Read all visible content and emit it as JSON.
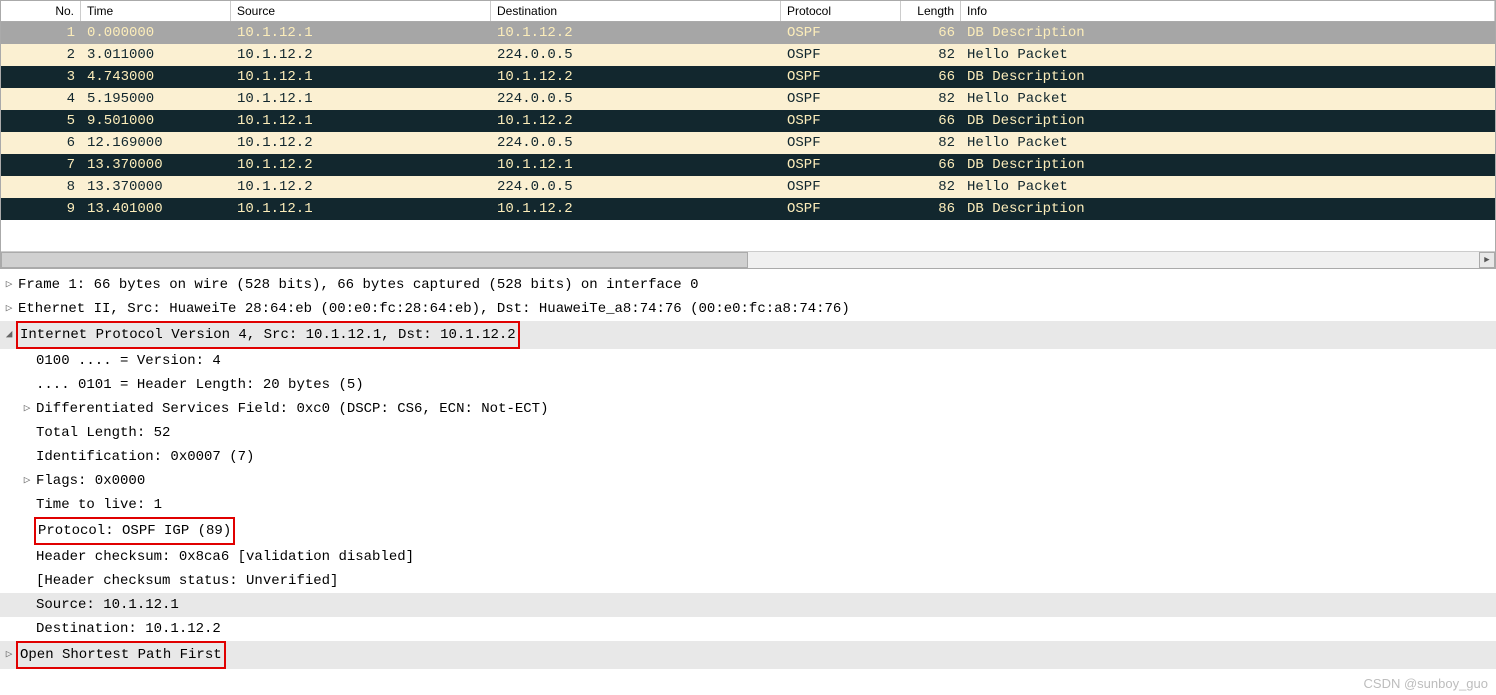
{
  "columns": {
    "no": "No.",
    "time": "Time",
    "src": "Source",
    "dst": "Destination",
    "proto": "Protocol",
    "len": "Length",
    "info": "Info"
  },
  "packets": [
    {
      "no": "1",
      "time": "0.000000",
      "src": "10.1.12.1",
      "dst": "10.1.12.2",
      "proto": "OSPF",
      "len": "66",
      "info": "DB Description",
      "theme": "sel"
    },
    {
      "no": "2",
      "time": "3.011000",
      "src": "10.1.12.2",
      "dst": "224.0.0.5",
      "proto": "OSPF",
      "len": "82",
      "info": "Hello Packet",
      "theme": "light"
    },
    {
      "no": "3",
      "time": "4.743000",
      "src": "10.1.12.1",
      "dst": "10.1.12.2",
      "proto": "OSPF",
      "len": "66",
      "info": "DB Description",
      "theme": "dark"
    },
    {
      "no": "4",
      "time": "5.195000",
      "src": "10.1.12.1",
      "dst": "224.0.0.5",
      "proto": "OSPF",
      "len": "82",
      "info": "Hello Packet",
      "theme": "light"
    },
    {
      "no": "5",
      "time": "9.501000",
      "src": "10.1.12.1",
      "dst": "10.1.12.2",
      "proto": "OSPF",
      "len": "66",
      "info": "DB Description",
      "theme": "dark"
    },
    {
      "no": "6",
      "time": "12.169000",
      "src": "10.1.12.2",
      "dst": "224.0.0.5",
      "proto": "OSPF",
      "len": "82",
      "info": "Hello Packet",
      "theme": "light"
    },
    {
      "no": "7",
      "time": "13.370000",
      "src": "10.1.12.2",
      "dst": "10.1.12.1",
      "proto": "OSPF",
      "len": "66",
      "info": "DB Description",
      "theme": "dark"
    },
    {
      "no": "8",
      "time": "13.370000",
      "src": "10.1.12.2",
      "dst": "224.0.0.5",
      "proto": "OSPF",
      "len": "82",
      "info": "Hello Packet",
      "theme": "light"
    },
    {
      "no": "9",
      "time": "13.401000",
      "src": "10.1.12.1",
      "dst": "10.1.12.2",
      "proto": "OSPF",
      "len": "86",
      "info": "DB Description",
      "theme": "dark"
    }
  ],
  "details": {
    "frame": "Frame 1: 66 bytes on wire (528 bits), 66 bytes captured (528 bits) on interface 0",
    "eth": "Ethernet II, Src: HuaweiTe 28:64:eb (00:e0:fc:28:64:eb), Dst: HuaweiTe_a8:74:76 (00:e0:fc:a8:74:76)",
    "ipv4_header": "Internet Protocol Version 4, Src: 10.1.12.1, Dst: 10.1.12.2",
    "ipv4": {
      "version": "0100 .... = Version: 4",
      "hdrlen": ".... 0101 = Header Length: 20 bytes (5)",
      "dscp": "Differentiated Services Field: 0xc0 (DSCP: CS6, ECN: Not-ECT)",
      "totlen": "Total Length: 52",
      "ident": "Identification: 0x0007 (7)",
      "flags": "Flags: 0x0000",
      "ttl": "Time to live: 1",
      "proto": "Protocol: OSPF IGP (89)",
      "cksum": "Header checksum: 0x8ca6 [validation disabled]",
      "cksum_status": "[Header checksum status: Unverified]",
      "src": "Source: 10.1.12.1",
      "dst": "Destination: 10.1.12.2"
    },
    "ospf": "Open Shortest Path First"
  },
  "watermark": "CSDN @sunboy_guo"
}
